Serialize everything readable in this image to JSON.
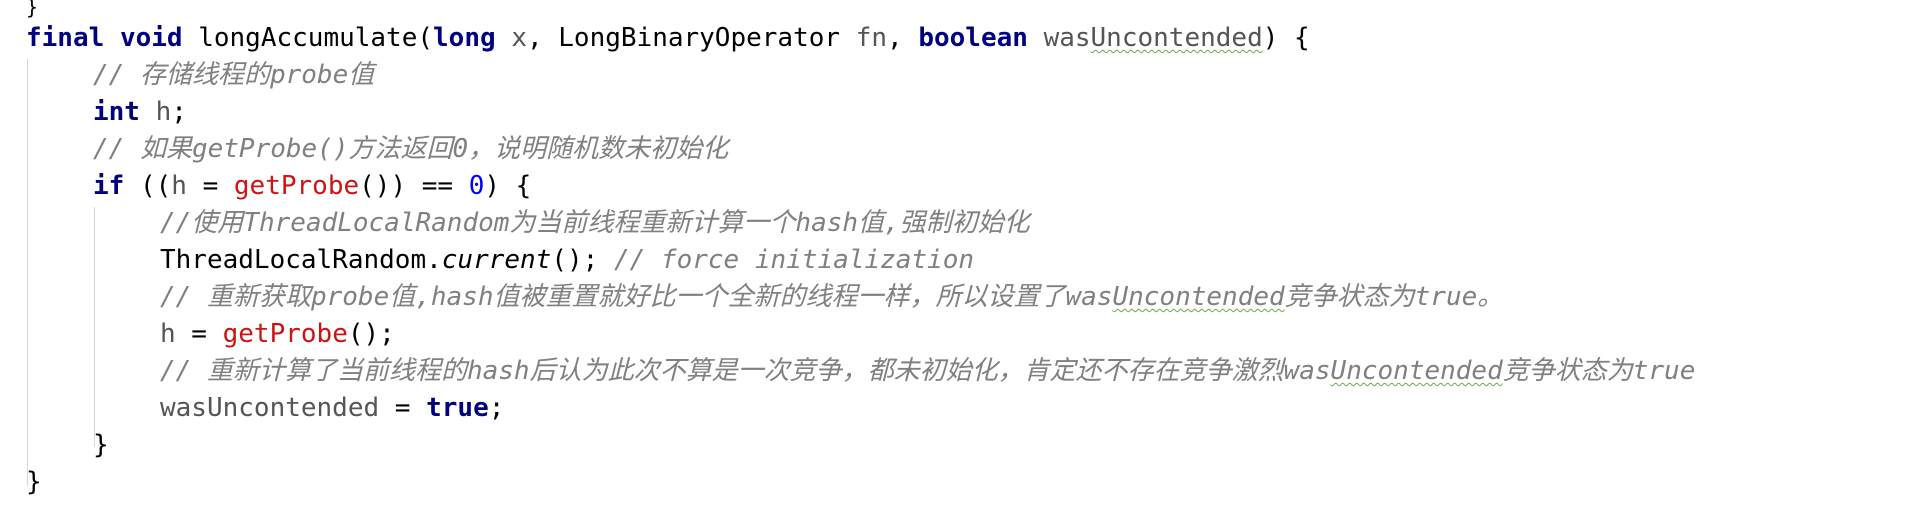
{
  "editor": {
    "top_fragment": "}",
    "lines": [
      {
        "tokens": [
          {
            "t": "final",
            "c": "kw"
          },
          {
            "t": " ",
            "c": ""
          },
          {
            "t": "void",
            "c": "kw"
          },
          {
            "t": " ",
            "c": ""
          },
          {
            "t": "longAccumulate",
            "c": "method"
          },
          {
            "t": "(",
            "c": ""
          },
          {
            "t": "long",
            "c": "kw"
          },
          {
            "t": " ",
            "c": ""
          },
          {
            "t": "x",
            "c": "param"
          },
          {
            "t": ", LongBinaryOperator ",
            "c": ""
          },
          {
            "t": "fn",
            "c": "param"
          },
          {
            "t": ", ",
            "c": ""
          },
          {
            "t": "boolean",
            "c": "kw"
          },
          {
            "t": " ",
            "c": ""
          },
          {
            "t": "was",
            "c": "param"
          },
          {
            "t": "Uncontended",
            "c": "param typo"
          },
          {
            "t": ") {",
            "c": ""
          }
        ]
      },
      {
        "indent": 1,
        "tokens": [
          {
            "t": "// 存储线程的probe值",
            "c": "comment"
          }
        ]
      },
      {
        "indent": 1,
        "tokens": [
          {
            "t": "int",
            "c": "kw"
          },
          {
            "t": " ",
            "c": ""
          },
          {
            "t": "h",
            "c": "param"
          },
          {
            "t": ";",
            "c": ""
          }
        ]
      },
      {
        "indent": 1,
        "tokens": [
          {
            "t": "// 如果getProbe()方法返回0，说明随机数未初始化",
            "c": "comment"
          }
        ]
      },
      {
        "indent": 1,
        "tokens": [
          {
            "t": "if",
            "c": "kw"
          },
          {
            "t": " ((",
            "c": ""
          },
          {
            "t": "h",
            "c": "param"
          },
          {
            "t": " = ",
            "c": ""
          },
          {
            "t": "getProbe",
            "c": "call"
          },
          {
            "t": "()) == ",
            "c": ""
          },
          {
            "t": "0",
            "c": "num"
          },
          {
            "t": ") {",
            "c": ""
          }
        ]
      },
      {
        "indent": 2,
        "tokens": [
          {
            "t": "//使用ThreadLocalRandom为当前线程重新计算一个hash值,强制初始化",
            "c": "comment"
          }
        ]
      },
      {
        "indent": 2,
        "tokens": [
          {
            "t": "ThreadLocalRandom.",
            "c": ""
          },
          {
            "t": "current",
            "c": "static-call"
          },
          {
            "t": "(); ",
            "c": ""
          },
          {
            "t": "// force initialization",
            "c": "comment"
          }
        ]
      },
      {
        "indent": 2,
        "tokens": [
          {
            "t": "// 重新获取probe值,hash值被重置就好比一个全新的线程一样，所以设置了was",
            "c": "comment"
          },
          {
            "t": "Uncontended",
            "c": "comment typo"
          },
          {
            "t": "竞争状态为true。",
            "c": "comment"
          }
        ]
      },
      {
        "indent": 2,
        "tokens": [
          {
            "t": "h",
            "c": "param"
          },
          {
            "t": " = ",
            "c": ""
          },
          {
            "t": "getProbe",
            "c": "call"
          },
          {
            "t": "();",
            "c": ""
          }
        ]
      },
      {
        "indent": 2,
        "tokens": [
          {
            "t": "// 重新计算了当前线程的hash后认为此次不算是一次竞争，都未初始化，肯定还不存在竞争激烈was",
            "c": "comment"
          },
          {
            "t": "Uncontended",
            "c": "comment typo"
          },
          {
            "t": "竞争状态为true",
            "c": "comment"
          }
        ]
      },
      {
        "indent": 2,
        "tokens": [
          {
            "t": "wasUncontended",
            "c": "param"
          },
          {
            "t": " = ",
            "c": ""
          },
          {
            "t": "true",
            "c": "kw"
          },
          {
            "t": ";",
            "c": ""
          }
        ]
      },
      {
        "indent": 1,
        "tokens": [
          {
            "t": "}",
            "c": ""
          }
        ]
      },
      {
        "tokens": [
          {
            "t": "}",
            "c": ""
          }
        ]
      }
    ]
  },
  "colors": {
    "keyword": "#000080",
    "method_call": "#cc1414",
    "number": "#0000ff",
    "comment": "#808080",
    "parameter": "#555555",
    "typo_underline": "#6aa84f"
  }
}
